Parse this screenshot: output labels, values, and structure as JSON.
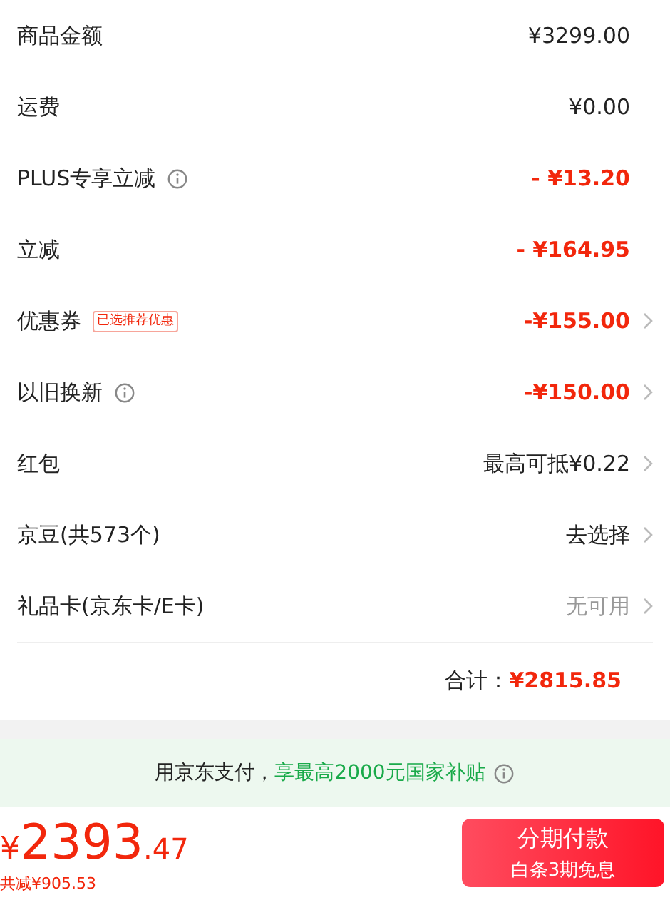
{
  "rows": [
    {
      "label": "商品金额",
      "info": false,
      "value": "¥3299.00",
      "kind": "normal",
      "chevron": false
    },
    {
      "label": "运费",
      "info": false,
      "value": "¥0.00",
      "kind": "normal",
      "chevron": false
    },
    {
      "label": "PLUS专享立减",
      "info": true,
      "value": "- ¥13.20",
      "kind": "discount",
      "chevron": false
    },
    {
      "label": "立减",
      "info": false,
      "value": "- ¥164.95",
      "kind": "discount",
      "chevron": false
    },
    {
      "label": "优惠券",
      "tag": "已选推荐优惠",
      "info": false,
      "value": "-¥155.00",
      "kind": "discount",
      "chevron": true
    },
    {
      "label": "以旧换新",
      "info": true,
      "value": "-¥150.00",
      "kind": "discount",
      "chevron": true
    },
    {
      "label": "红包",
      "info": false,
      "value": "最高可抵¥0.22",
      "kind": "normal",
      "chevron": true
    },
    {
      "label": "京豆(共573个)",
      "info": false,
      "value": "去选择",
      "kind": "normal",
      "chevron": true
    },
    {
      "label": "礼品卡(京东卡/E卡)",
      "info": false,
      "value": "无可用",
      "kind": "muted",
      "chevron": true
    }
  ],
  "total": {
    "label": "合计：",
    "value": "¥2815.85"
  },
  "banner": {
    "text": "用京东支付，",
    "highlight": "享最高2000元国家补贴"
  },
  "footer": {
    "currency": "¥",
    "integer": "2393",
    "decimal": ".47",
    "savings": "共减¥905.53",
    "button_title": "分期付款",
    "button_subtitle": "白条3期免息"
  }
}
